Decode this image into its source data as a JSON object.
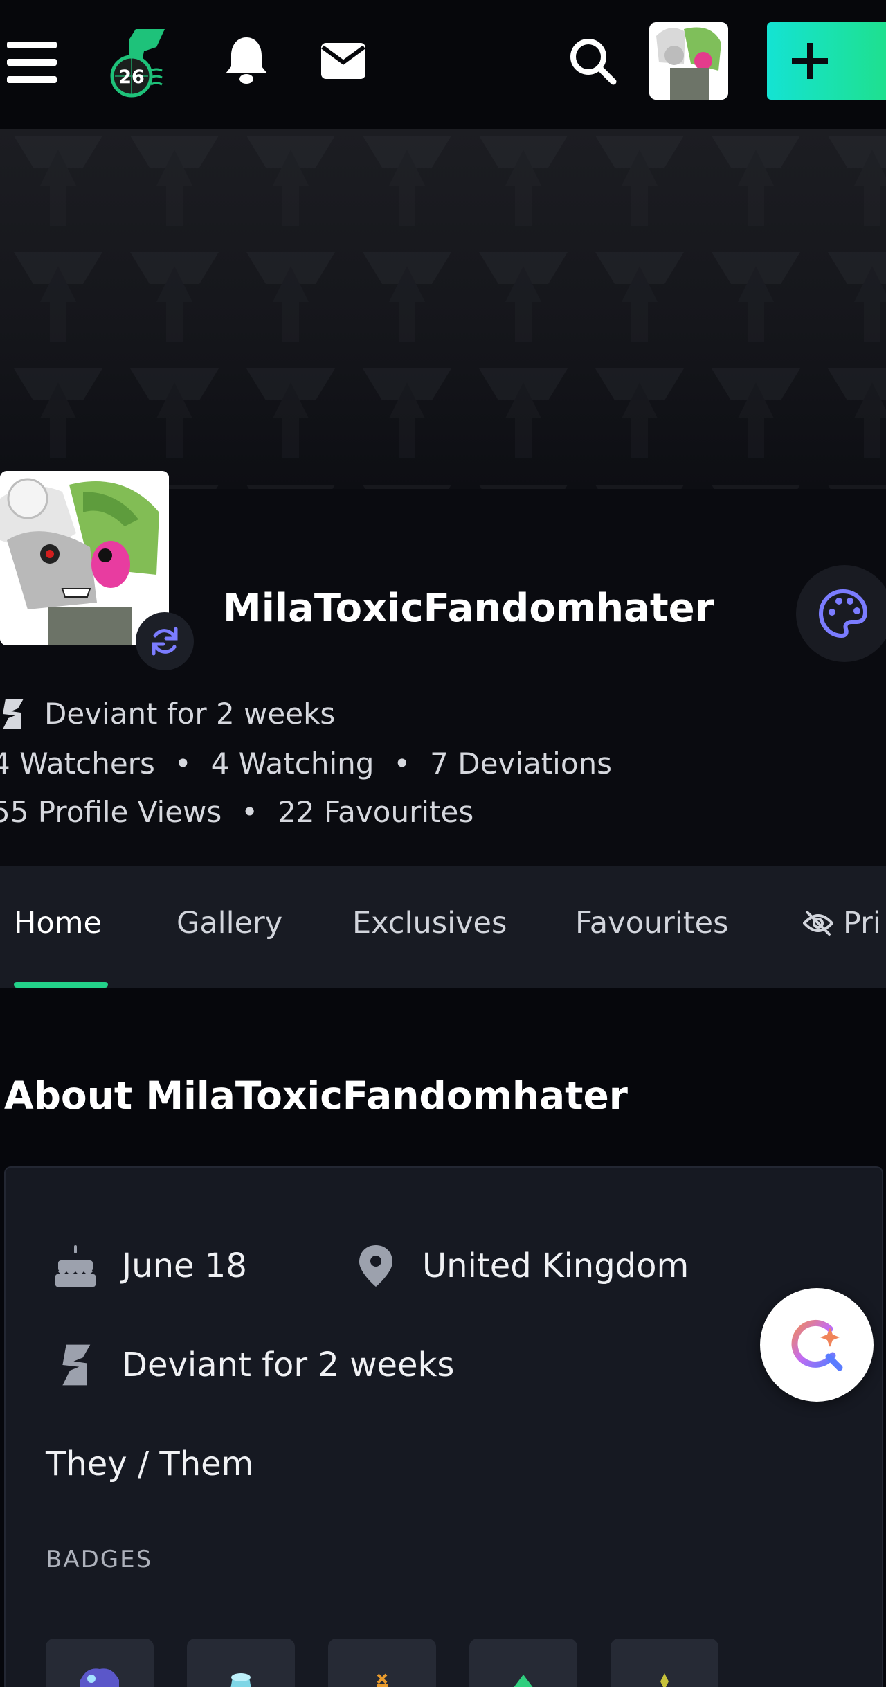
{
  "topbar": {
    "logo_badge": "26",
    "icons": [
      "menu-icon",
      "deviantart-logo-icon",
      "bell-icon",
      "mail-icon",
      "search-icon",
      "plus-icon"
    ]
  },
  "profile": {
    "username": "MilaToxicFandomhater",
    "deviant_for": "Deviant for 2 weeks",
    "watchers": "4 Watchers",
    "watching": "4 Watching",
    "deviations": "7 Deviations",
    "profile_views": "55 Profile Views",
    "favourites": "22 Favourites",
    "separator": "•"
  },
  "tabs": [
    {
      "label": "Home",
      "active": true
    },
    {
      "label": "Gallery",
      "active": false
    },
    {
      "label": "Exclusives",
      "active": false
    },
    {
      "label": "Favourites",
      "active": false
    },
    {
      "label": "Pri",
      "active": false
    }
  ],
  "about": {
    "title": "About MilaToxicFandomhater",
    "birthday": "June 18",
    "location": "United Kingdom",
    "deviant_for": "Deviant for 2 weeks",
    "pronouns": "They / Them",
    "badges_label": "BADGES"
  },
  "colors": {
    "accent_green": "#23d28a",
    "create_gradient_start": "#14e3d3",
    "create_gradient_end": "#1fe08c",
    "palette_purple": "#7b7cff"
  }
}
